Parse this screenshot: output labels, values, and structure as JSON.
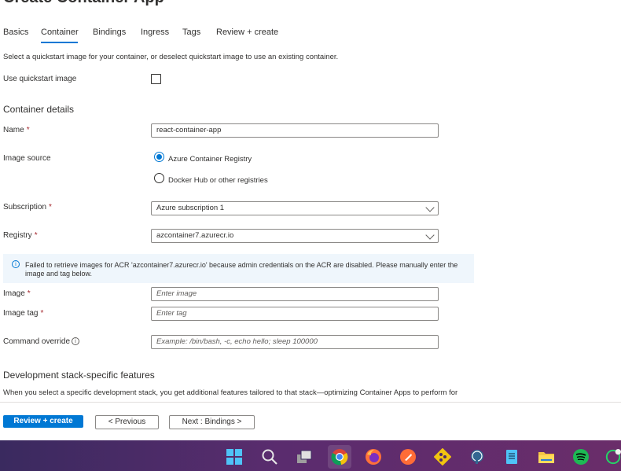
{
  "page_title": "Create Container App",
  "tabs": [
    {
      "label": "Basics"
    },
    {
      "label": "Container"
    },
    {
      "label": "Bindings"
    },
    {
      "label": "Ingress"
    },
    {
      "label": "Tags"
    },
    {
      "label": "Review + create"
    }
  ],
  "active_tab": "Container",
  "intro_text": "Select a quickstart image for your container, or deselect quickstart image to use an existing container.",
  "quickstart": {
    "label": "Use quickstart image",
    "checked": false
  },
  "container_details_heading": "Container details",
  "name": {
    "label": "Name",
    "required_mark": "*",
    "value": "react-container-app"
  },
  "image_source": {
    "label": "Image source",
    "options": [
      {
        "label": "Azure Container Registry",
        "selected": true
      },
      {
        "label": "Docker Hub or other registries",
        "selected": false
      }
    ]
  },
  "subscription": {
    "label": "Subscription",
    "required_mark": "*",
    "value": "Azure subscription 1"
  },
  "registry": {
    "label": "Registry",
    "required_mark": "*",
    "value": "azcontainer7.azurecr.io"
  },
  "info_message": "Failed to retrieve images for ACR 'azcontainer7.azurecr.io' because admin credentials on the ACR are disabled. Please manually enter the image and tag below.",
  "image": {
    "label": "Image",
    "required_mark": "*",
    "placeholder": "Enter image"
  },
  "image_tag": {
    "label": "Image tag",
    "required_mark": "*",
    "placeholder": "Enter tag"
  },
  "command_override": {
    "label": "Command override",
    "placeholder": "Example: /bin/bash, -c, echo hello; sleep 100000"
  },
  "dev_stack_heading": "Development stack-specific features",
  "dev_stack_text": "When you select a specific development stack, you get additional features tailored to that stack—optimizing Container Apps to perform for",
  "footer": {
    "review_create": "Review + create",
    "previous": "< Previous",
    "next": "Next : Bindings >"
  },
  "colors": {
    "accent": "#0078d4",
    "required": "#a4262c",
    "info_bg": "#eff6fc"
  },
  "taskbar_icons": [
    "windows-start-icon",
    "search-icon",
    "task-view-icon",
    "chrome-icon",
    "firefox-icon",
    "postman-icon",
    "git-icon",
    "postgresql-icon",
    "notepad-icon",
    "file-explorer-icon",
    "spotify-icon",
    "whatsapp-icon"
  ]
}
